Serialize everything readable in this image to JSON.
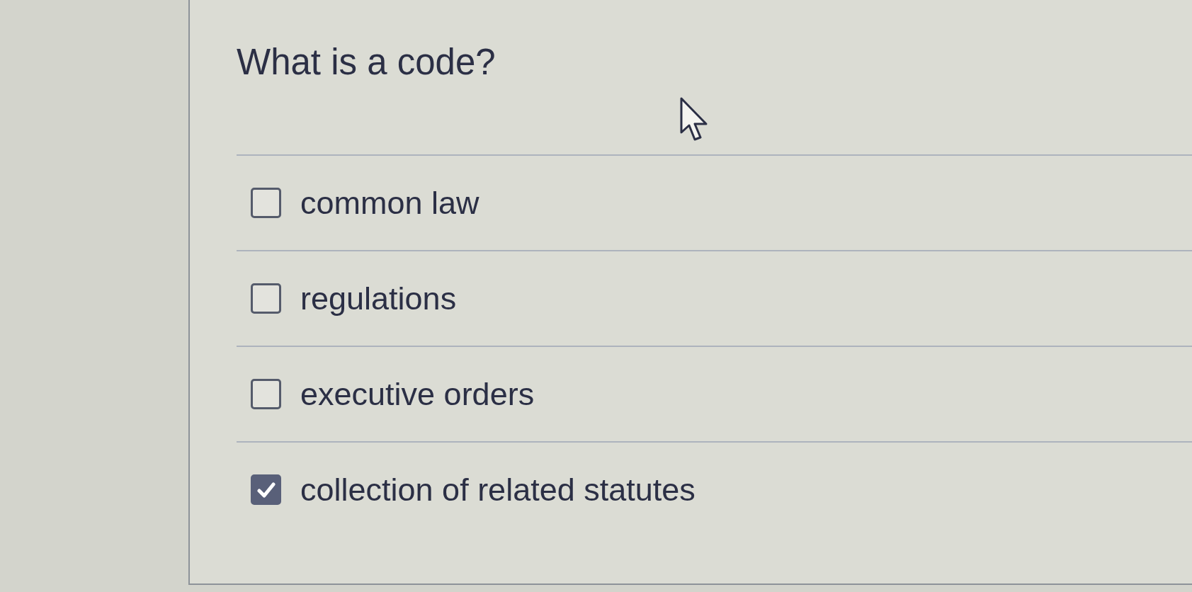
{
  "question": {
    "title": "What is a code?"
  },
  "options": [
    {
      "label": "common law",
      "checked": false
    },
    {
      "label": "regulations",
      "checked": false
    },
    {
      "label": "executive orders",
      "checked": false
    },
    {
      "label": "collection of related statutes",
      "checked": true
    }
  ]
}
